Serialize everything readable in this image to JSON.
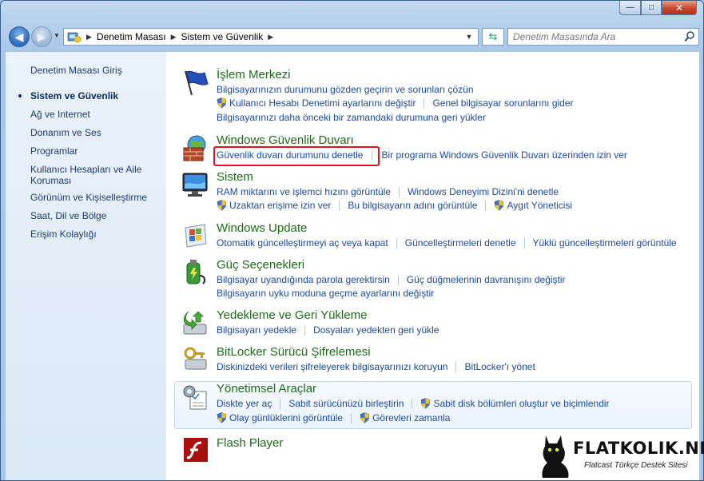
{
  "window": {
    "buttons": {
      "minimize": "—",
      "maximize": "□",
      "close": "✕"
    }
  },
  "address_bar": {
    "crumbs": [
      "Denetim Masası",
      "Sistem ve Güvenlik"
    ]
  },
  "search": {
    "placeholder": "Denetim Masasında Ara"
  },
  "sidebar": {
    "items": [
      {
        "label": "Denetim Masası Giriş",
        "active": false
      },
      {
        "label": "Sistem ve Güvenlik",
        "active": true
      },
      {
        "label": "Ağ ve Internet",
        "active": false
      },
      {
        "label": "Donanım ve Ses",
        "active": false
      },
      {
        "label": "Programlar",
        "active": false
      },
      {
        "label": "Kullanıcı Hesapları ve Aile Koruması",
        "active": false
      },
      {
        "label": "Görünüm ve Kişiselleştirme",
        "active": false
      },
      {
        "label": "Saat, Dil ve Bölge",
        "active": false
      },
      {
        "label": "Erişim Kolaylığı",
        "active": false
      }
    ]
  },
  "categories": {
    "islem": {
      "title": "İşlem Merkezi",
      "row1": [
        "Bilgisayarınızın durumunu gözden geçirin ve sorunları çözün"
      ],
      "row2": [
        "Kullanıcı Hesabı Denetimi ayarlarını değiştir",
        "Genel bilgisayar sorunlarını gider"
      ],
      "row3": [
        "Bilgisayarınızı daha önceki bir zamandaki durumuna geri yükler"
      ]
    },
    "firewall": {
      "title": "Windows Güvenlik Duvarı",
      "row1": [
        "Güvenlik duvarı durumunu denetle",
        "Bir programa Windows Güvenlik Duvarı üzerinden izin ver"
      ]
    },
    "sistem": {
      "title": "Sistem",
      "row1": [
        "RAM miktarını ve işlemci hızını görüntüle",
        "Windows Deneyimi Dizini'ni denetle"
      ],
      "row2": [
        "Uzaktan erişime izin ver",
        "Bu bilgisayarın adını görüntüle",
        "Aygıt Yöneticisi"
      ]
    },
    "update": {
      "title": "Windows Update",
      "row1": [
        "Otomatik güncelleştirmeyi aç veya kapat",
        "Güncelleştirmeleri denetle",
        "Yüklü güncelleştirmeleri görüntüle"
      ]
    },
    "guc": {
      "title": "Güç Seçenekleri",
      "row1": [
        "Bilgisayar uyandığında parola gerektirsin",
        "Güç düğmelerinin davranışını değiştir"
      ],
      "row2": [
        "Bilgisayarın uyku moduna geçme ayarlarını değiştir"
      ]
    },
    "yedek": {
      "title": "Yedekleme ve Geri Yükleme",
      "row1": [
        "Bilgisayarı yedekle",
        "Dosyaları yedekten geri yükle"
      ]
    },
    "bitlocker": {
      "title": "BitLocker Sürücü Şifrelemesi",
      "row1": [
        "Diskinizdeki verileri şifreleyerek bilgisayarınızı koruyun",
        "BitLocker'ı yönet"
      ]
    },
    "yonetim": {
      "title": "Yönetimsel Araçlar",
      "row1": [
        "Diskte yer aç",
        "Sabit sürücünüzü birleştirin",
        "Sabit disk bölümleri oluştur ve biçimlendir"
      ],
      "row2": [
        "Olay günlüklerini görüntüle",
        "Görevleri zamanla"
      ]
    },
    "flash": {
      "title": "Flash Player"
    }
  },
  "watermark": {
    "brand": "FLATKOLIK.NET",
    "tagline": "Flatcast Türkçe Destek Sitesi"
  },
  "colors": {
    "link": "#1c4aa6",
    "category": "#1c6d19",
    "highlight": "#e0141a"
  }
}
